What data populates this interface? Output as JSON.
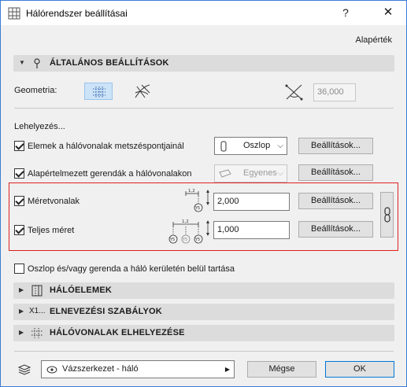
{
  "window": {
    "title": "Hálórendszer beállításai",
    "help": "?",
    "close": "✕"
  },
  "preset_link": "Alapérték",
  "general_section": {
    "title": "ÁLTALÁNOS BEÁLLÍTÁSOK"
  },
  "geometry": {
    "label": "Geometria:",
    "angle_value": "36,000"
  },
  "placement": {
    "heading": "Lehelyezés...",
    "columns": {
      "label": "Elemek a hálóvonalak metszéspontjainál",
      "checked": true,
      "select_value": "Oszlop",
      "settings_label": "Beállítások..."
    },
    "beams": {
      "label": "Alapértelmezett gerendák a hálóvonalakon",
      "checked": true,
      "select_value": "Egyenes",
      "settings_label": "Beállítások..."
    },
    "dimension_lines": {
      "label": "Méretvonalak",
      "checked": true,
      "value": "2,000",
      "settings_label": "Beállítások...",
      "icon_value": "1,2",
      "icon_tag": "Y5"
    },
    "total_dimension": {
      "label": "Teljes méret",
      "checked": true,
      "value": "1,000",
      "settings_label": "Beállítások...",
      "icon_value": "1,2",
      "icon_tag": "Y5"
    }
  },
  "boundary_checkbox": {
    "label": "Oszlop és/vagy gerenda a háló kerületén belül tartása",
    "checked": false
  },
  "sections": [
    {
      "title": "HÁLÓELEMEK",
      "icon": "grid-elements-icon"
    },
    {
      "title": "ELNEVEZÉSI SZABÁLYOK",
      "icon": "naming-rules-icon",
      "icon_text": "X1..."
    },
    {
      "title": "HÁLÓVONALAK ELHELYEZÉSE",
      "icon": "gridlines-placement-icon"
    }
  ],
  "footer": {
    "layer_value": "Vázszerkezet - háló",
    "cancel_label": "Mégse",
    "ok_label": "OK"
  },
  "colors": {
    "highlight": "#e02020",
    "accent": "#0078d7",
    "section_bg": "#dcdcdc"
  }
}
